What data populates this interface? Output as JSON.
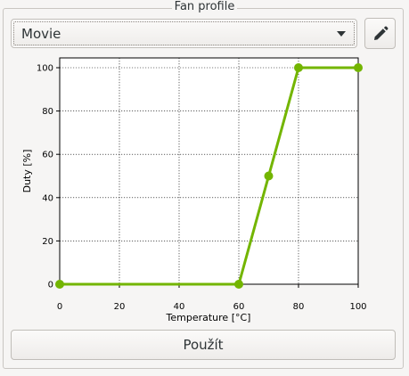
{
  "frame": {
    "title": "Fan profile"
  },
  "profile_select": {
    "value": "Movie"
  },
  "icons": {
    "edit": "pencil-icon",
    "dropdown": "chevron-down-icon"
  },
  "apply_button": {
    "label": "Použít"
  },
  "colors": {
    "curve": "#73b500",
    "background": "#f6f5f4"
  },
  "chart_data": {
    "type": "line",
    "xlabel": "Temperature [°C]",
    "ylabel": "Duty [%]",
    "xlim": [
      0,
      100
    ],
    "ylim": [
      0,
      100
    ],
    "xticks": [
      0,
      20,
      40,
      60,
      80,
      100
    ],
    "yticks": [
      0,
      20,
      40,
      60,
      80,
      100
    ],
    "grid": true,
    "series": [
      {
        "style": "solid",
        "markers": true,
        "x": [
          0,
          60,
          70,
          80,
          100
        ],
        "y": [
          0,
          0,
          50,
          100,
          100
        ]
      },
      {
        "style": "dotted",
        "markers": false,
        "x": [
          0,
          60,
          80,
          100
        ],
        "y": [
          0,
          0,
          100,
          100
        ]
      }
    ]
  }
}
